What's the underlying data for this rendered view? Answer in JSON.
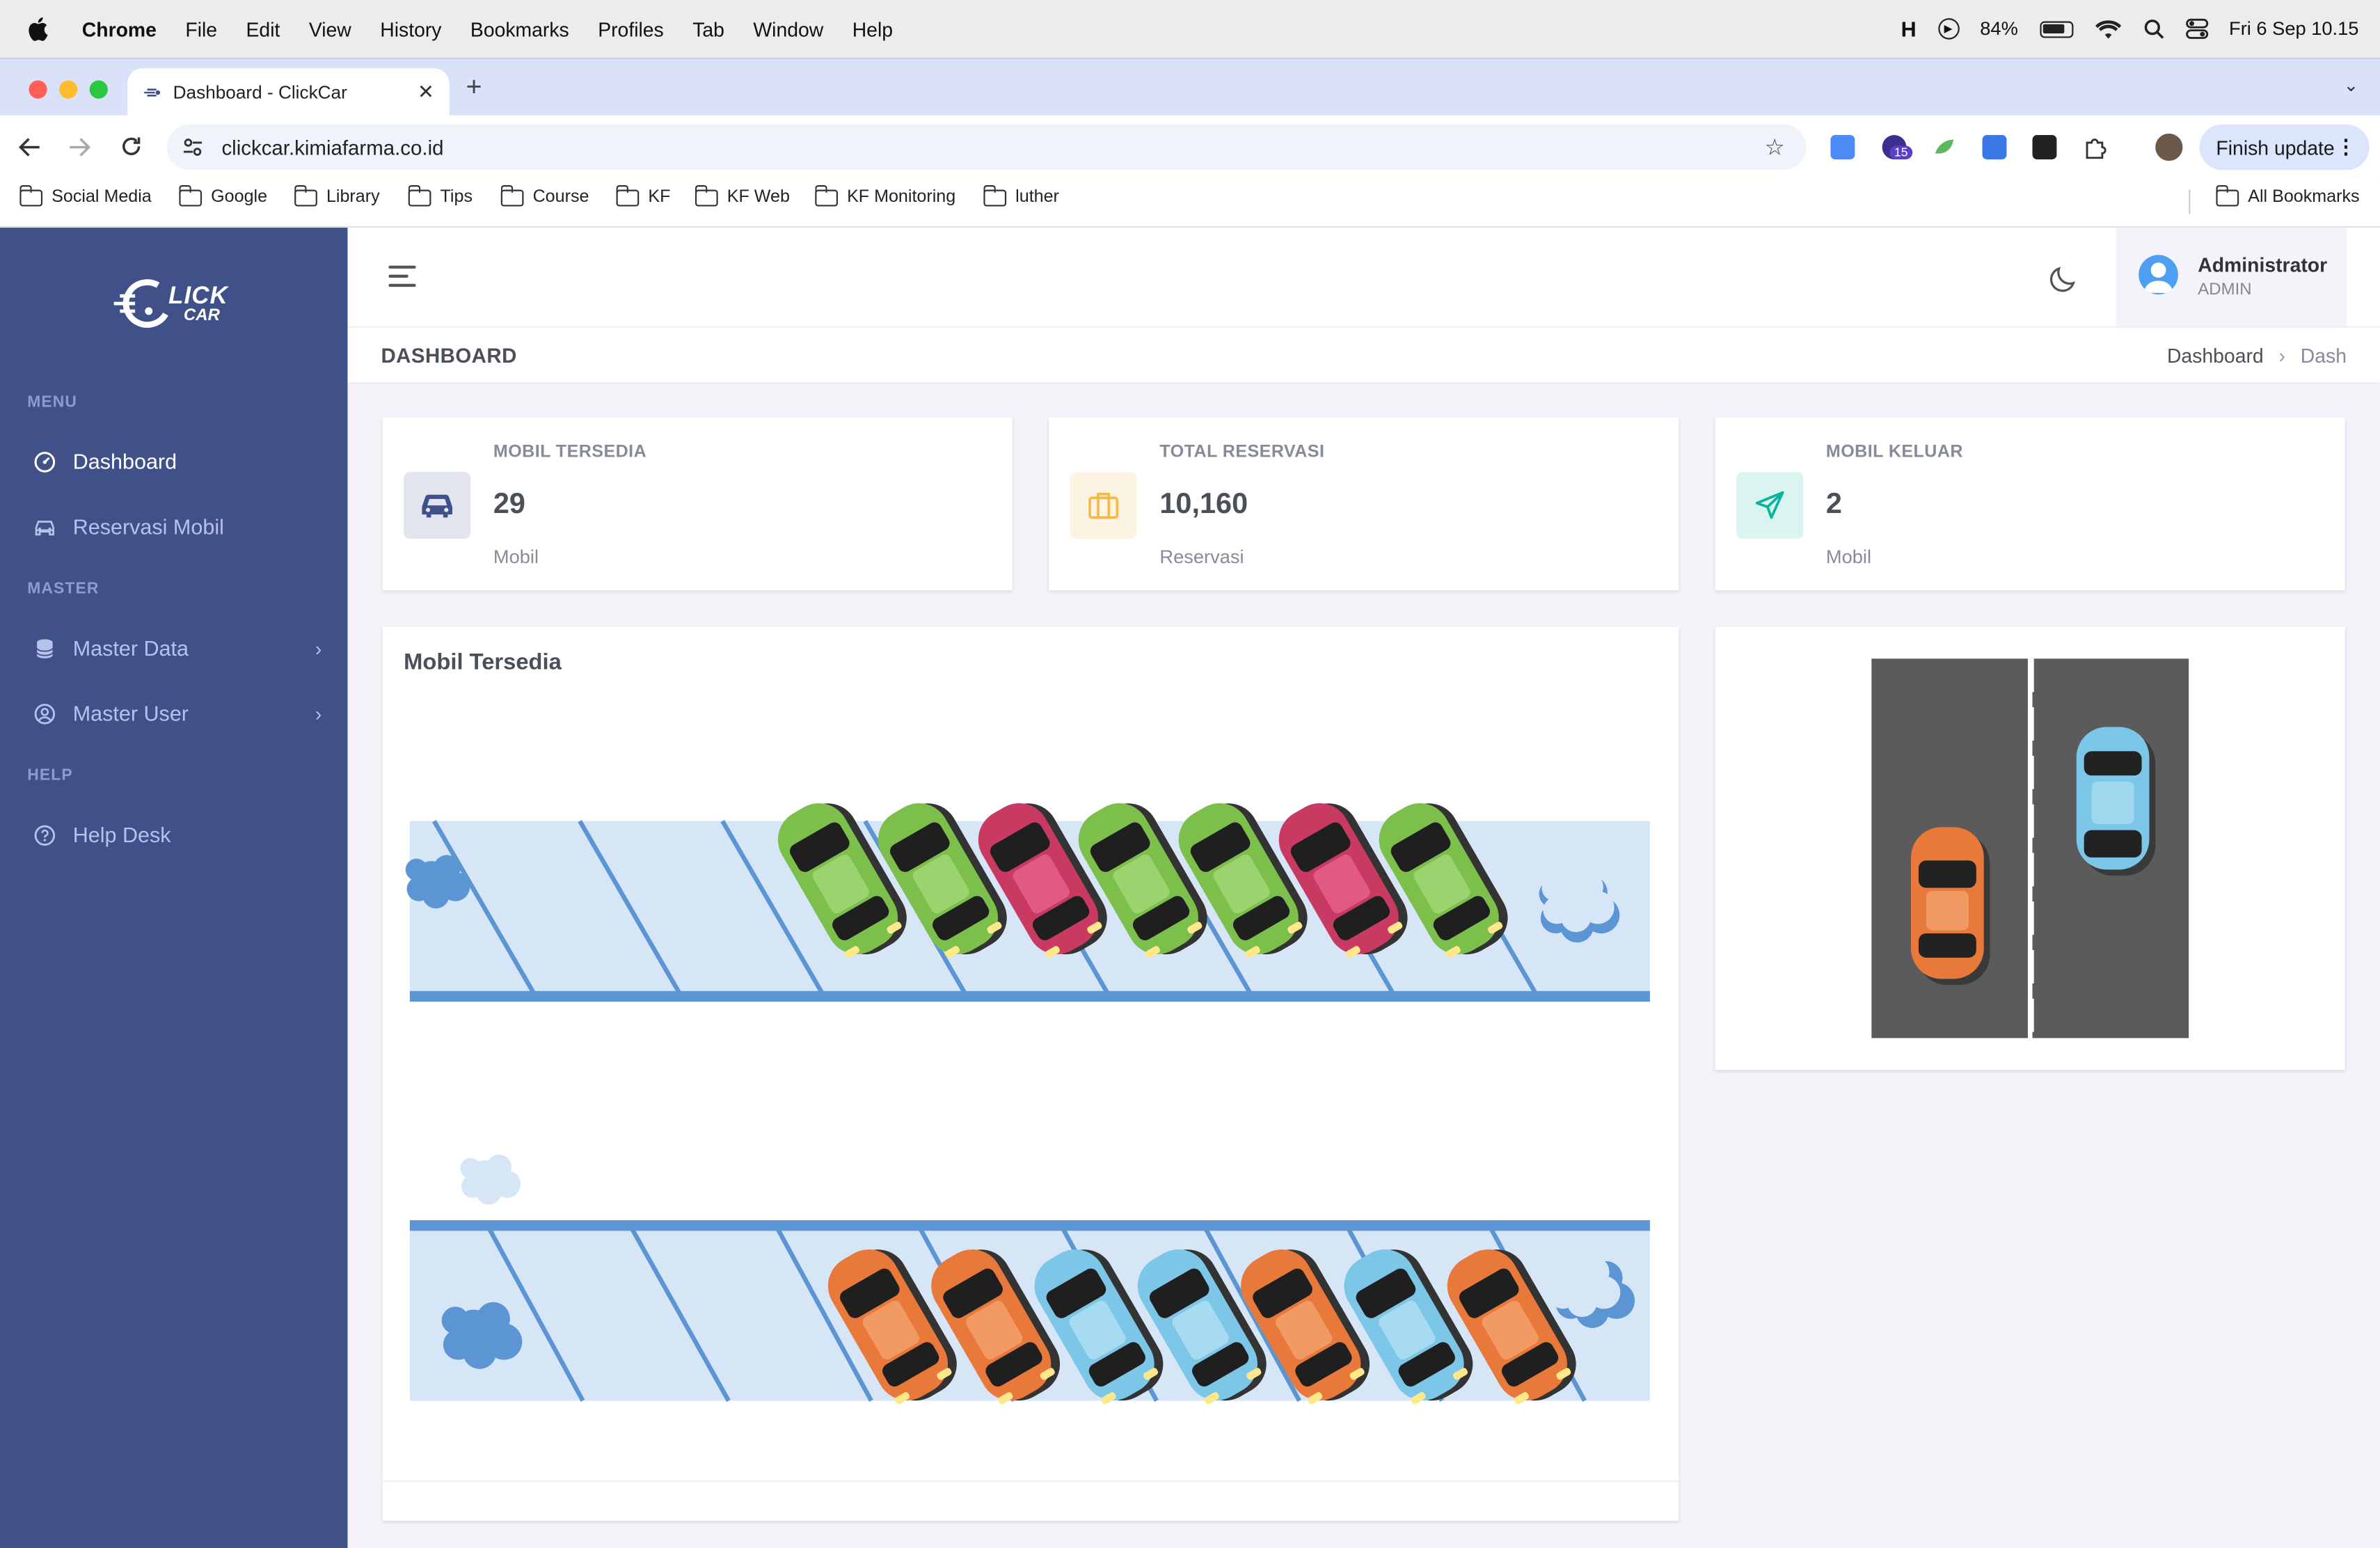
{
  "menubar": {
    "app": "Chrome",
    "items": [
      "File",
      "Edit",
      "View",
      "History",
      "Bookmarks",
      "Profiles",
      "Tab",
      "Window",
      "Help"
    ],
    "battery": "84%",
    "datetime": "Fri 6 Sep  10.15"
  },
  "browser": {
    "tab_title": "Dashboard - ClickCar",
    "url": "clickcar.kimiafarma.co.id",
    "ext_badge": "15",
    "finish_update": "Finish update",
    "bookmarks": [
      "Social Media",
      "Google",
      "Library",
      "Tips",
      "Course",
      "KF",
      "KF Web",
      "KF Monitoring",
      "luther"
    ],
    "all_bookmarks": "All Bookmarks"
  },
  "sidebar": {
    "logo_text": "LICK",
    "logo_sub": "CAR",
    "sections": [
      "MENU",
      "MASTER",
      "HELP"
    ],
    "items": [
      {
        "label": "Dashboard",
        "icon": "dashboard-gauge-icon"
      },
      {
        "label": "Reservasi Mobil",
        "icon": "car-icon"
      },
      {
        "label": "Master Data",
        "icon": "database-icon"
      },
      {
        "label": "Master User",
        "icon": "user-circle-icon"
      },
      {
        "label": "Help Desk",
        "icon": "question-circle-icon"
      }
    ]
  },
  "header": {
    "user_name": "Administrator",
    "user_role": "ADMIN"
  },
  "page": {
    "title": "DASHBOARD",
    "breadcrumb": [
      "Dashboard",
      "Dash"
    ]
  },
  "stats": [
    {
      "label": "MOBIL TERSEDIA",
      "value": "29",
      "unit": "Mobil",
      "icon": "car-icon",
      "color": "#405189"
    },
    {
      "label": "TOTAL RESERVASI",
      "value": "10,160",
      "unit": "Reservasi",
      "icon": "briefcase-icon",
      "color": "#f7b84b"
    },
    {
      "label": "MOBIL KELUAR",
      "value": "2",
      "unit": "Mobil",
      "icon": "send-icon",
      "color": "#0ab39c"
    }
  ],
  "panels": {
    "available_title": "Mobil Tersedia"
  },
  "colors": {
    "sidebar": "#405189",
    "car_green": "#7cc04b",
    "car_red": "#c93a62",
    "car_orange": "#e8793a",
    "car_blue": "#7cc6e8",
    "lane_blue": "#5b95d3"
  }
}
